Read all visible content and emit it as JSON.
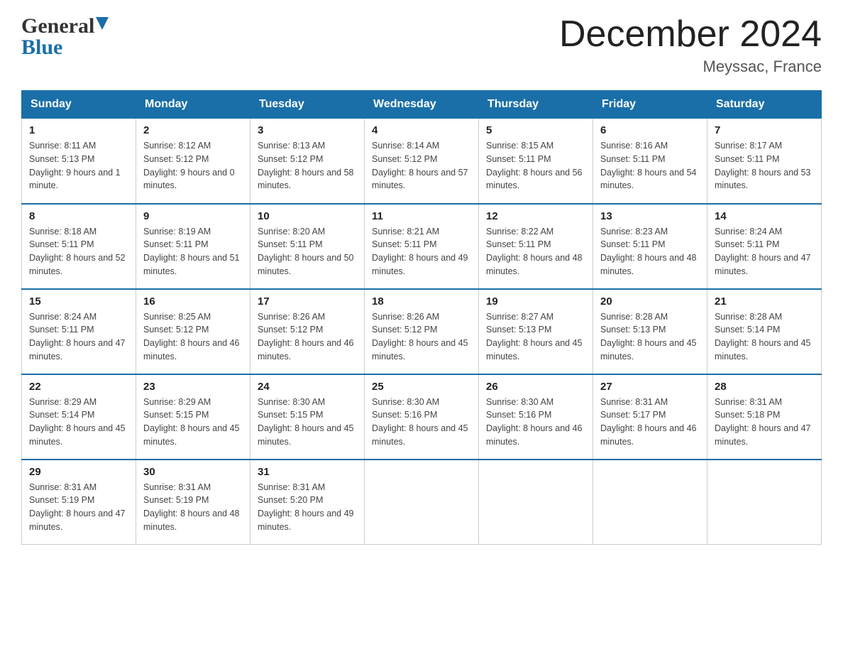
{
  "header": {
    "logo_general": "General",
    "logo_blue": "Blue",
    "month_title": "December 2024",
    "location": "Meyssac, France"
  },
  "days_of_week": [
    "Sunday",
    "Monday",
    "Tuesday",
    "Wednesday",
    "Thursday",
    "Friday",
    "Saturday"
  ],
  "weeks": [
    [
      {
        "day": "1",
        "sunrise": "8:11 AM",
        "sunset": "5:13 PM",
        "daylight": "9 hours and 1 minute."
      },
      {
        "day": "2",
        "sunrise": "8:12 AM",
        "sunset": "5:12 PM",
        "daylight": "9 hours and 0 minutes."
      },
      {
        "day": "3",
        "sunrise": "8:13 AM",
        "sunset": "5:12 PM",
        "daylight": "8 hours and 58 minutes."
      },
      {
        "day": "4",
        "sunrise": "8:14 AM",
        "sunset": "5:12 PM",
        "daylight": "8 hours and 57 minutes."
      },
      {
        "day": "5",
        "sunrise": "8:15 AM",
        "sunset": "5:11 PM",
        "daylight": "8 hours and 56 minutes."
      },
      {
        "day": "6",
        "sunrise": "8:16 AM",
        "sunset": "5:11 PM",
        "daylight": "8 hours and 54 minutes."
      },
      {
        "day": "7",
        "sunrise": "8:17 AM",
        "sunset": "5:11 PM",
        "daylight": "8 hours and 53 minutes."
      }
    ],
    [
      {
        "day": "8",
        "sunrise": "8:18 AM",
        "sunset": "5:11 PM",
        "daylight": "8 hours and 52 minutes."
      },
      {
        "day": "9",
        "sunrise": "8:19 AM",
        "sunset": "5:11 PM",
        "daylight": "8 hours and 51 minutes."
      },
      {
        "day": "10",
        "sunrise": "8:20 AM",
        "sunset": "5:11 PM",
        "daylight": "8 hours and 50 minutes."
      },
      {
        "day": "11",
        "sunrise": "8:21 AM",
        "sunset": "5:11 PM",
        "daylight": "8 hours and 49 minutes."
      },
      {
        "day": "12",
        "sunrise": "8:22 AM",
        "sunset": "5:11 PM",
        "daylight": "8 hours and 48 minutes."
      },
      {
        "day": "13",
        "sunrise": "8:23 AM",
        "sunset": "5:11 PM",
        "daylight": "8 hours and 48 minutes."
      },
      {
        "day": "14",
        "sunrise": "8:24 AM",
        "sunset": "5:11 PM",
        "daylight": "8 hours and 47 minutes."
      }
    ],
    [
      {
        "day": "15",
        "sunrise": "8:24 AM",
        "sunset": "5:11 PM",
        "daylight": "8 hours and 47 minutes."
      },
      {
        "day": "16",
        "sunrise": "8:25 AM",
        "sunset": "5:12 PM",
        "daylight": "8 hours and 46 minutes."
      },
      {
        "day": "17",
        "sunrise": "8:26 AM",
        "sunset": "5:12 PM",
        "daylight": "8 hours and 46 minutes."
      },
      {
        "day": "18",
        "sunrise": "8:26 AM",
        "sunset": "5:12 PM",
        "daylight": "8 hours and 45 minutes."
      },
      {
        "day": "19",
        "sunrise": "8:27 AM",
        "sunset": "5:13 PM",
        "daylight": "8 hours and 45 minutes."
      },
      {
        "day": "20",
        "sunrise": "8:28 AM",
        "sunset": "5:13 PM",
        "daylight": "8 hours and 45 minutes."
      },
      {
        "day": "21",
        "sunrise": "8:28 AM",
        "sunset": "5:14 PM",
        "daylight": "8 hours and 45 minutes."
      }
    ],
    [
      {
        "day": "22",
        "sunrise": "8:29 AM",
        "sunset": "5:14 PM",
        "daylight": "8 hours and 45 minutes."
      },
      {
        "day": "23",
        "sunrise": "8:29 AM",
        "sunset": "5:15 PM",
        "daylight": "8 hours and 45 minutes."
      },
      {
        "day": "24",
        "sunrise": "8:30 AM",
        "sunset": "5:15 PM",
        "daylight": "8 hours and 45 minutes."
      },
      {
        "day": "25",
        "sunrise": "8:30 AM",
        "sunset": "5:16 PM",
        "daylight": "8 hours and 45 minutes."
      },
      {
        "day": "26",
        "sunrise": "8:30 AM",
        "sunset": "5:16 PM",
        "daylight": "8 hours and 46 minutes."
      },
      {
        "day": "27",
        "sunrise": "8:31 AM",
        "sunset": "5:17 PM",
        "daylight": "8 hours and 46 minutes."
      },
      {
        "day": "28",
        "sunrise": "8:31 AM",
        "sunset": "5:18 PM",
        "daylight": "8 hours and 47 minutes."
      }
    ],
    [
      {
        "day": "29",
        "sunrise": "8:31 AM",
        "sunset": "5:19 PM",
        "daylight": "8 hours and 47 minutes."
      },
      {
        "day": "30",
        "sunrise": "8:31 AM",
        "sunset": "5:19 PM",
        "daylight": "8 hours and 48 minutes."
      },
      {
        "day": "31",
        "sunrise": "8:31 AM",
        "sunset": "5:20 PM",
        "daylight": "8 hours and 49 minutes."
      },
      null,
      null,
      null,
      null
    ]
  ]
}
